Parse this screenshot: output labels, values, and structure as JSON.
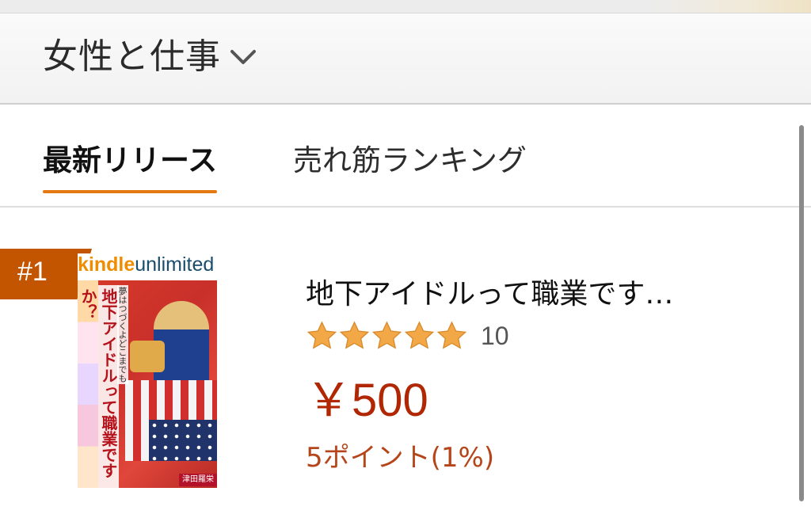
{
  "header": {
    "category": "女性と仕事",
    "dropdown_icon": "chevron-down-icon"
  },
  "tabs": [
    {
      "label": "最新リリース",
      "active": true
    },
    {
      "label": "売れ筋ランキング",
      "active": false
    }
  ],
  "product": {
    "rank": "#1",
    "cover": {
      "badge_kindle": "kindle",
      "badge_unlimited": "unlimited",
      "title": "地下アイドルって職業ですか？",
      "subtitle": "夢はつづくよどこまでも",
      "author": "津田羅栄"
    },
    "title": "地下アイドルって職業です…",
    "rating_stars": 5,
    "review_count": "10",
    "price": "￥500",
    "points": "5ポイント(1%)"
  },
  "colors": {
    "accent": "#e47911",
    "rank_badge": "#c45500",
    "price": "#b12704",
    "points": "#b5461b",
    "star": "#f3a847"
  }
}
